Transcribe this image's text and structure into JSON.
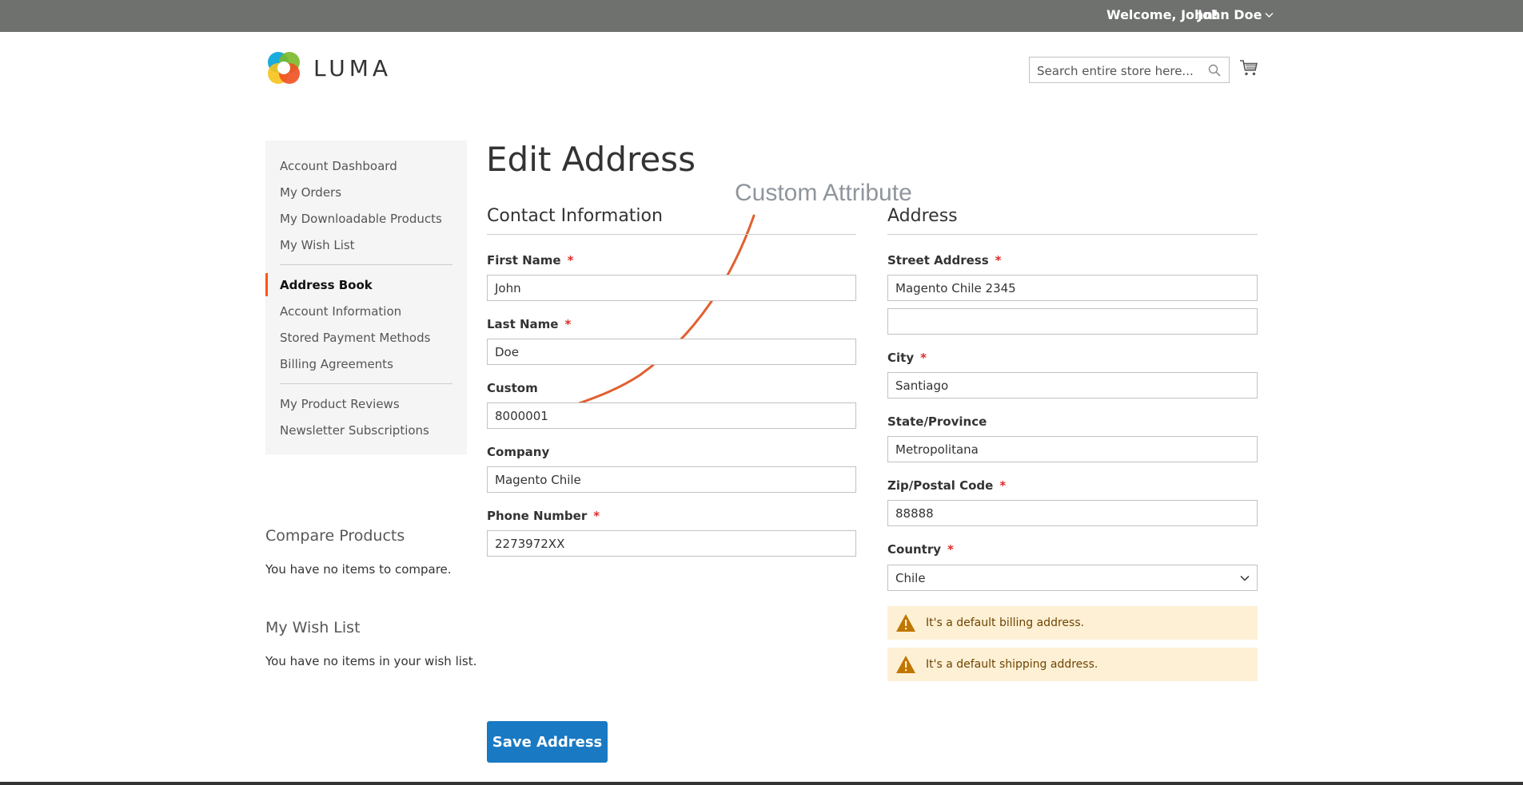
{
  "topbar": {
    "welcome": "Welcome, John!",
    "user_name": "John Doe"
  },
  "header": {
    "logo_text": "LUMA",
    "search_placeholder": "Search entire store here...",
    "accent": "#ff5501"
  },
  "sidebar": {
    "items": [
      {
        "label": "Account Dashboard"
      },
      {
        "label": "My Orders"
      },
      {
        "label": "My Downloadable Products"
      },
      {
        "label": "My Wish List"
      },
      {
        "label": "Address Book",
        "active": true
      },
      {
        "label": "Account Information"
      },
      {
        "label": "Stored Payment Methods"
      },
      {
        "label": "Billing Agreements"
      },
      {
        "label": "My Product Reviews"
      },
      {
        "label": "Newsletter Subscriptions"
      }
    ],
    "compare": {
      "title": "Compare Products",
      "text": "You have no items to compare."
    },
    "wishlist": {
      "title": "My Wish List",
      "text": "You have no items in your wish list."
    }
  },
  "main": {
    "title": "Edit Address",
    "annotation": "Custom Attribute",
    "contact": {
      "title": "Contact Information",
      "first_name": {
        "label": "First Name",
        "value": "John"
      },
      "last_name": {
        "label": "Last Name",
        "value": "Doe"
      },
      "custom": {
        "label": "Custom",
        "value": "8000001"
      },
      "company": {
        "label": "Company",
        "value": "Magento Chile"
      },
      "phone": {
        "label": "Phone Number",
        "value": "2273972XX"
      }
    },
    "address": {
      "title": "Address",
      "street": {
        "label": "Street Address",
        "value": "Magento Chile 2345",
        "value2": ""
      },
      "city": {
        "label": "City",
        "value": "Santiago"
      },
      "region": {
        "label": "State/Province",
        "value": "Metropolitana"
      },
      "zip": {
        "label": "Zip/Postal Code",
        "value": "88888"
      },
      "country": {
        "label": "Country",
        "value": "Chile"
      },
      "notice_billing": "It's a default billing address.",
      "notice_shipping": "It's a default shipping address."
    },
    "required_marker": "*",
    "save_label": "Save Address",
    "button_color": "#1979c3"
  }
}
